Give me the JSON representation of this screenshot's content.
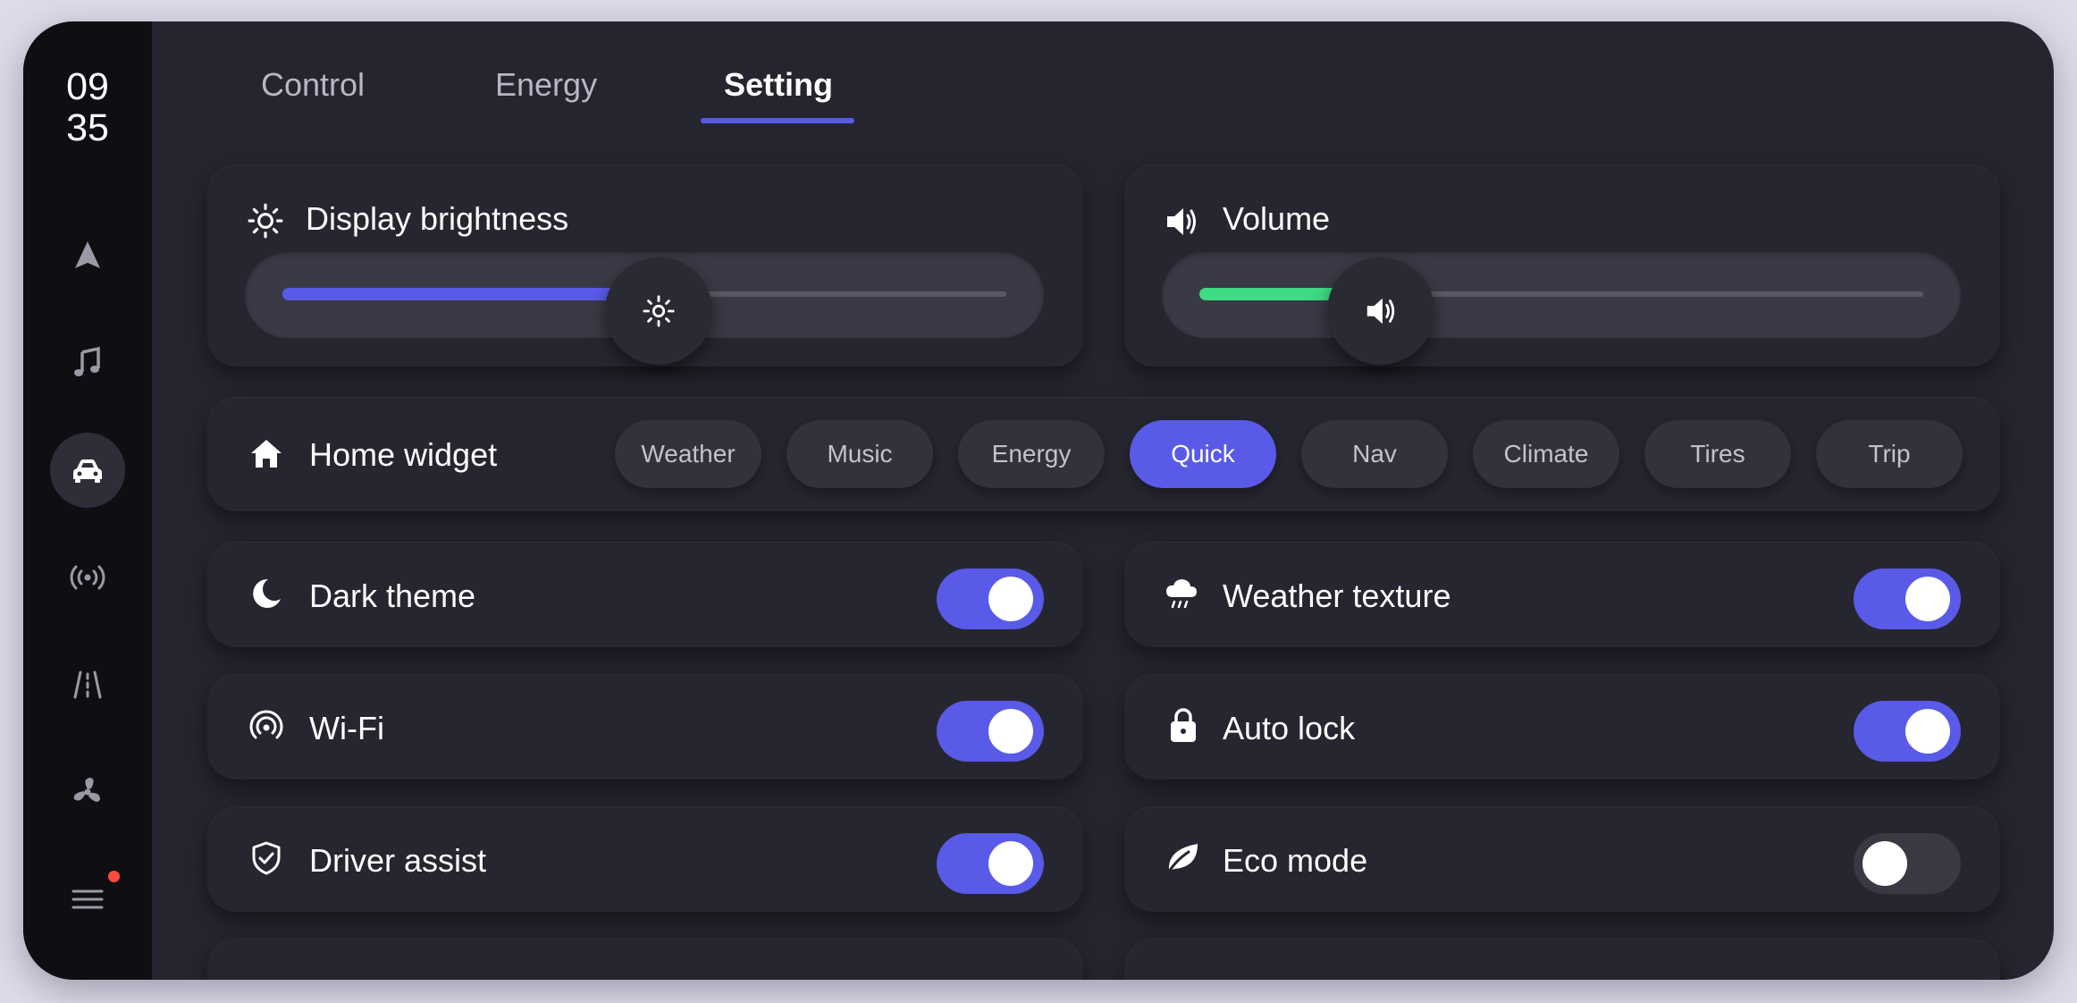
{
  "clock": {
    "hours": "09",
    "minutes": "35"
  },
  "tabs": [
    {
      "label": "Control"
    },
    {
      "label": "Energy"
    },
    {
      "label": "Setting"
    }
  ],
  "active_tab": "Setting",
  "brightness": {
    "label": "Display brightness",
    "value_percent": 52,
    "color": "#5a5ae8"
  },
  "volume": {
    "label": "Volume",
    "value_percent": 25,
    "color": "#3ddc84"
  },
  "home_widget": {
    "label": "Home widget",
    "options": [
      "Weather",
      "Music",
      "Energy",
      "Quick",
      "Nav",
      "Climate",
      "Tires",
      "Trip"
    ],
    "selected": "Quick"
  },
  "toggles": [
    {
      "label": "Dark theme",
      "icon": "moon-icon",
      "on": true
    },
    {
      "label": "Weather texture",
      "icon": "cloud-rain-icon",
      "on": true
    },
    {
      "label": "Wi-Fi",
      "icon": "wifi-icon",
      "on": true
    },
    {
      "label": "Auto lock",
      "icon": "lock-icon",
      "on": true
    },
    {
      "label": "Driver assist",
      "icon": "shield-check-icon",
      "on": true
    },
    {
      "label": "Eco mode",
      "icon": "leaf-icon",
      "on": false
    }
  ],
  "sidebar": {
    "items": [
      "navigation-icon",
      "music-icon",
      "car-icon",
      "radio-icon",
      "road-icon",
      "fan-icon",
      "menu-icon"
    ],
    "active": "car-icon",
    "notification_dot_color": "#ff4a40"
  },
  "accent_color": "#5a5ae8"
}
